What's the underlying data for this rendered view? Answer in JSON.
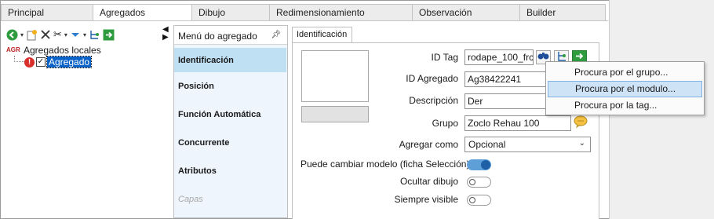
{
  "tabs": [
    "Principal",
    "Agregados",
    "Dibujo",
    "Redimensionamiento",
    "Observación",
    "Builder"
  ],
  "active_tab": "Agregados",
  "toolbar": {
    "icons": [
      "back-green-icon",
      "new-icon",
      "delete-x-icon",
      "scissors-icon",
      "down-blue-icon",
      "tree-icon",
      "export-green-icon"
    ]
  },
  "tree": {
    "root_badge": "AGR",
    "root_label": "Agregados locales",
    "child_label": "Agregado",
    "child_warning": "!"
  },
  "menu": {
    "header": "Menú do agregado",
    "items": [
      "Identificación",
      "Posición",
      "Función Automática",
      "Concurrente",
      "Atributos",
      "Capas"
    ]
  },
  "content_tab": "Identificación",
  "form": {
    "id_tag_label": "ID Tag",
    "id_tag_value": "rodape_100_frc",
    "id_agregado_label": "ID Agregado",
    "id_agregado_value": "Ag38422241",
    "descripcion_label": "Descripción",
    "descripcion_value": "Der",
    "grupo_label": "Grupo",
    "grupo_value": "Zoclo Rehau 100",
    "agregar_como_label": "Agregar como",
    "agregar_como_value": "Opcional",
    "puede_cambiar_label": "Puede cambiar modelo (ficha Selección)",
    "puede_cambiar_on": true,
    "ocultar_label": "Ocultar dibujo",
    "ocultar_on": false,
    "siempre_label": "Siempre visible",
    "siempre_on": false
  },
  "context_menu": {
    "items": [
      "Procura por el grupo...",
      "Procura por el modulo...",
      "Procura por la tag..."
    ],
    "highlighted": "Procura por el modulo..."
  }
}
